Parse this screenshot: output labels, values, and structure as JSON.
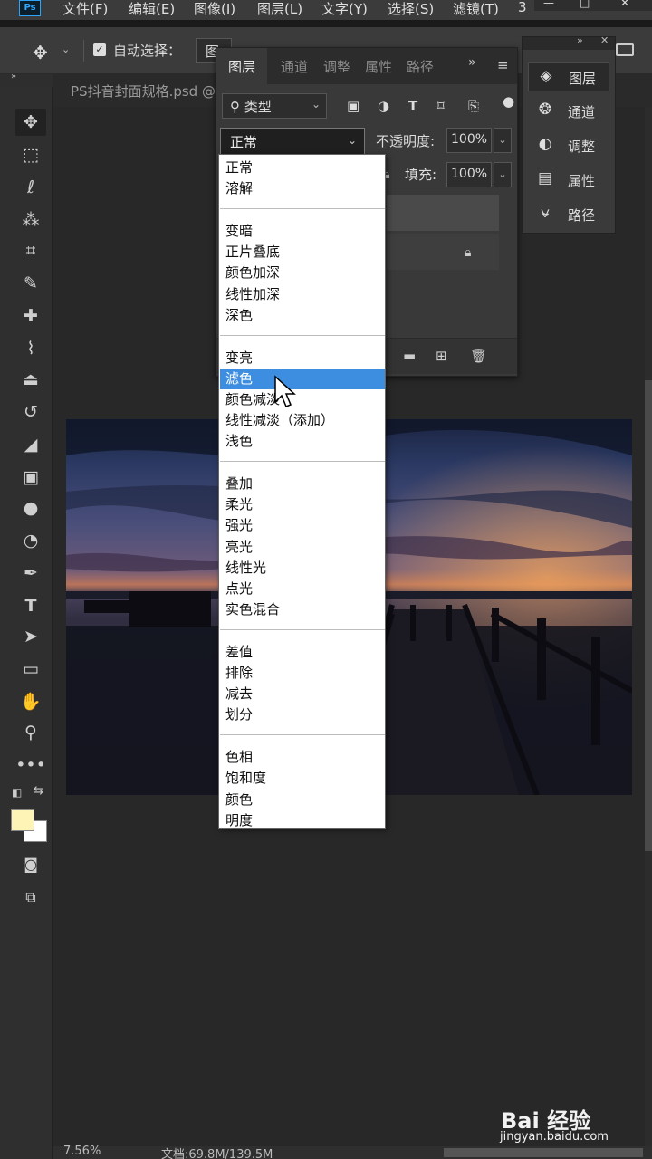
{
  "app": {
    "logo": "Ps"
  },
  "menu": [
    "文件(F)",
    "编辑(E)",
    "图像(I)",
    "图层(L)",
    "文字(Y)",
    "选择(S)",
    "滤镜(T)",
    "3"
  ],
  "options_bar": {
    "auto_select_label": "自动选择：",
    "auto_select_value": "图",
    "auto_select_checked": true
  },
  "document": {
    "tab": "PS抖音封面规格.psd @",
    "zoom": "7.56%",
    "doc_info": "文档:69.8M/139.5M"
  },
  "layers_panel": {
    "tabs": [
      "图层",
      "通道",
      "调整",
      "属性",
      "路径"
    ],
    "active_tab": "图层",
    "more": "»",
    "kind_filter": "类型",
    "blend_mode": "正常",
    "opacity_label": "不透明度:",
    "opacity_value": "100%",
    "fill_label": "填充:",
    "fill_value": "100%"
  },
  "side_panel": {
    "items": [
      {
        "label": "图层",
        "icon": "layers-icon"
      },
      {
        "label": "通道",
        "icon": "channels-icon"
      },
      {
        "label": "调整",
        "icon": "adjustments-icon"
      },
      {
        "label": "属性",
        "icon": "properties-icon"
      },
      {
        "label": "路径",
        "icon": "paths-icon"
      }
    ],
    "active": "图层"
  },
  "blend_dropdown": {
    "groups": [
      [
        "正常",
        "溶解"
      ],
      [
        "变暗",
        "正片叠底",
        "颜色加深",
        "线性加深",
        "深色"
      ],
      [
        "变亮",
        "滤色",
        "颜色减淡",
        "线性减淡（添加）",
        "浅色"
      ],
      [
        "叠加",
        "柔光",
        "强光",
        "亮光",
        "线性光",
        "点光",
        "实色混合"
      ],
      [
        "差值",
        "排除",
        "减去",
        "划分"
      ],
      [
        "色相",
        "饱和度",
        "颜色",
        "明度"
      ]
    ],
    "highlighted": "滤色"
  },
  "colors": {
    "foreground": "#fdf4b6",
    "background": "#ffffff",
    "highlight": "#3d8ee0"
  },
  "watermark": {
    "brand": "Bai 经验",
    "url": "jingyan.baidu.com"
  }
}
